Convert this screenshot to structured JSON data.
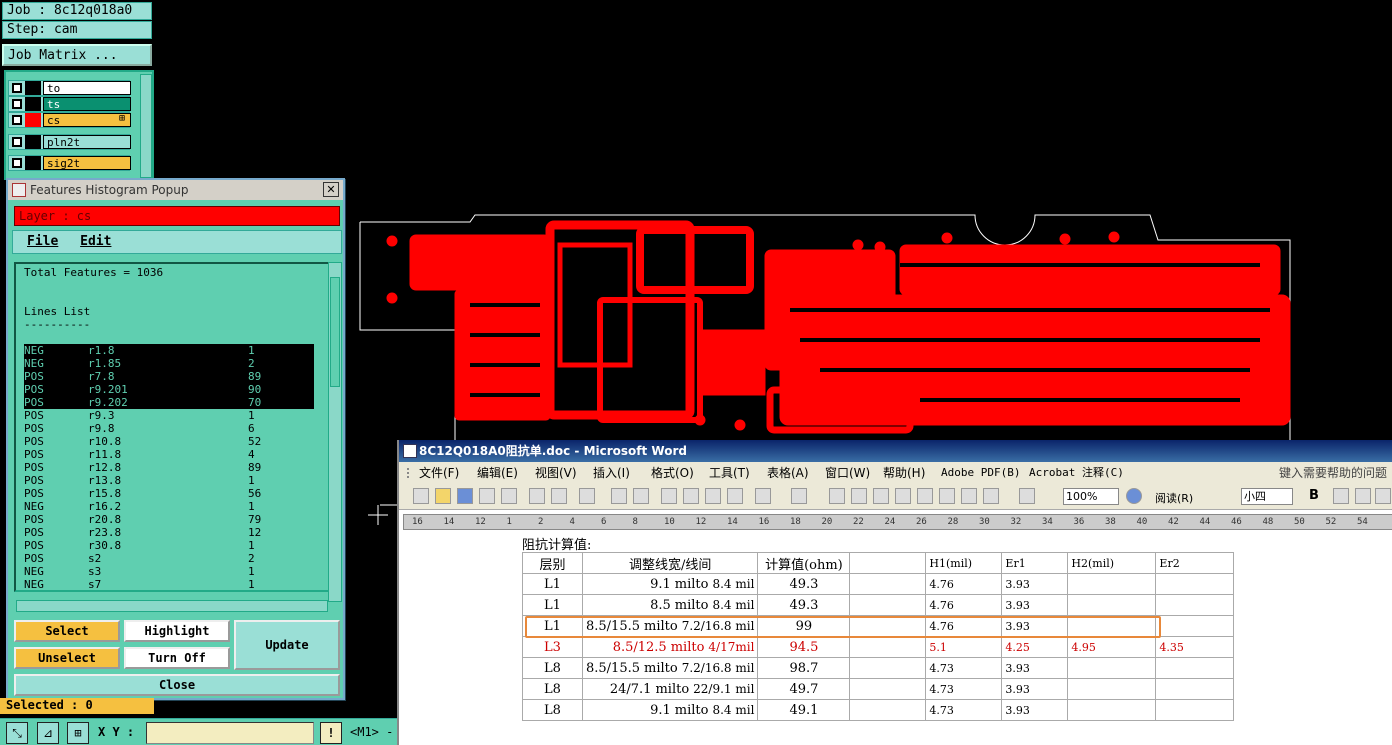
{
  "left_panel": {
    "job_label": "Job : 8c12q018a0",
    "step_label": "Step: cam",
    "job_matrix_button": "Job Matrix ...",
    "layers": [
      {
        "name": "to",
        "color": "#ffffff",
        "chip": "#000000"
      },
      {
        "name": "ts",
        "color": "#0a9070",
        "chip": "#000000"
      },
      {
        "name": "cs",
        "color": "#f5c040",
        "chip": "#ff0000",
        "marker": "⊞"
      },
      {
        "name": "pln2t",
        "color": "#9adfd6",
        "chip": "#000000"
      },
      {
        "name": "sig2t",
        "color": "#f5c040",
        "chip": "#000000"
      }
    ],
    "selected_status": "Selected : 0"
  },
  "popup": {
    "title": "Features Histogram Popup",
    "close_glyph": "✕",
    "layer_label": "Layer :  cs",
    "menu": {
      "file": "File",
      "edit": "Edit"
    },
    "total_features": "Total Features = 1036",
    "lines_list_title": "Lines List",
    "lines_list_underline": "----------",
    "rows": [
      {
        "pol": "NEG",
        "sym": "r1.8",
        "count": "1",
        "hl": true
      },
      {
        "pol": "NEG",
        "sym": "r1.85",
        "count": "2",
        "hl": true
      },
      {
        "pol": "POS",
        "sym": "r7.8",
        "count": "89",
        "hl": true
      },
      {
        "pol": "POS",
        "sym": "r9.201",
        "count": "90",
        "hl": true
      },
      {
        "pol": "POS",
        "sym": "r9.202",
        "count": "70",
        "hl": true
      },
      {
        "pol": "POS",
        "sym": "r9.3",
        "count": "1",
        "hl": false
      },
      {
        "pol": "POS",
        "sym": "r9.8",
        "count": "6",
        "hl": false
      },
      {
        "pol": "POS",
        "sym": "r10.8",
        "count": "52",
        "hl": false
      },
      {
        "pol": "POS",
        "sym": "r11.8",
        "count": "4",
        "hl": false
      },
      {
        "pol": "POS",
        "sym": "r12.8",
        "count": "89",
        "hl": false
      },
      {
        "pol": "POS",
        "sym": "r13.8",
        "count": "1",
        "hl": false
      },
      {
        "pol": "POS",
        "sym": "r15.8",
        "count": "56",
        "hl": false
      },
      {
        "pol": "NEG",
        "sym": "r16.2",
        "count": "1",
        "hl": false
      },
      {
        "pol": "POS",
        "sym": "r20.8",
        "count": "79",
        "hl": false
      },
      {
        "pol": "POS",
        "sym": "r23.8",
        "count": "12",
        "hl": false
      },
      {
        "pol": "POS",
        "sym": "r30.8",
        "count": "1",
        "hl": false
      },
      {
        "pol": "POS",
        "sym": "s2",
        "count": "2",
        "hl": false
      },
      {
        "pol": "NEG",
        "sym": "s3",
        "count": "1",
        "hl": false
      },
      {
        "pol": "NEG",
        "sym": "s7",
        "count": "1",
        "hl": false
      }
    ],
    "buttons": {
      "select": "Select",
      "highlight": "Highlight",
      "update": "Update",
      "unselect": "Unselect",
      "turn_off": "Turn Off",
      "close": "Close"
    }
  },
  "bottom_bar": {
    "xy_label": "X Y :",
    "warn_glyph": "!",
    "mode_label": "<M1> -"
  },
  "word": {
    "title": "8C12Q018A0阻抗单.doc - Microsoft Word",
    "menu": [
      "文件(F)",
      "编辑(E)",
      "视图(V)",
      "插入(I)",
      "格式(O)",
      "工具(T)",
      "表格(A)",
      "窗口(W)",
      "帮助(H)",
      "Adobe PDF(B)",
      "Acrobat 注释(C)"
    ],
    "help_hint": "键入需要帮助的问题",
    "zoom": "100%",
    "read_button": "阅读(R)",
    "font_size": "小四",
    "bold": "B",
    "ruler_labels": [
      "16",
      "14",
      "12",
      "1",
      "2",
      "4",
      "6",
      "8",
      "10",
      "12",
      "14",
      "16",
      "18",
      "20",
      "22",
      "24",
      "26",
      "28",
      "30",
      "32",
      "34",
      "36",
      "38",
      "40",
      "42",
      "44",
      "46",
      "48",
      "50",
      "52",
      "54"
    ],
    "section_title": "阻抗计算值:",
    "table_header": [
      "层别",
      "调整线宽/线间",
      "计算值(ohm)",
      "",
      "H1(mil)",
      "Er1",
      "H2(mil)",
      "Er2"
    ],
    "table_rows": [
      {
        "layer": "L1",
        "a": "9.1",
        "b": "milto",
        "c": "8.4 mil",
        "v": "49.3",
        "h1": "4.76",
        "er1": "3.93",
        "h2": "",
        "er2": "",
        "red": false
      },
      {
        "layer": "L1",
        "a": "8.5",
        "b": "milto",
        "c": "8.4 mil",
        "v": "49.3",
        "h1": "4.76",
        "er1": "3.93",
        "h2": "",
        "er2": "",
        "red": false
      },
      {
        "layer": "L1",
        "a": "8.5/15.5",
        "b": "milto",
        "c": "7.2/16.8 mil",
        "v": "99",
        "h1": "4.76",
        "er1": "3.93",
        "h2": "",
        "er2": "",
        "red": false
      },
      {
        "layer": "L3",
        "a": "8.5/12.5",
        "b": "milto",
        "c": "4/17mil",
        "v": "94.5",
        "h1": "5.1",
        "er1": "4.25",
        "h2": "4.95",
        "er2": "4.35",
        "red": true
      },
      {
        "layer": "L8",
        "a": "8.5/15.5",
        "b": "milto",
        "c": "7.2/16.8 mil",
        "v": "98.7",
        "h1": "4.73",
        "er1": "3.93",
        "h2": "",
        "er2": "",
        "red": false
      },
      {
        "layer": "L8",
        "a": "24/7.1",
        "b": "milto",
        "c": "22/9.1 mil",
        "v": "49.7",
        "h1": "4.73",
        "er1": "3.93",
        "h2": "",
        "er2": "",
        "red": false
      },
      {
        "layer": "L8",
        "a": "9.1",
        "b": "milto",
        "c": "8.4 mil",
        "v": "49.1",
        "h1": "4.73",
        "er1": "3.93",
        "h2": "",
        "er2": "",
        "red": false
      }
    ]
  },
  "colors": {
    "pcb_red": "#ff0000",
    "teal": "#5fcfb0",
    "outline": "#ffffff"
  }
}
